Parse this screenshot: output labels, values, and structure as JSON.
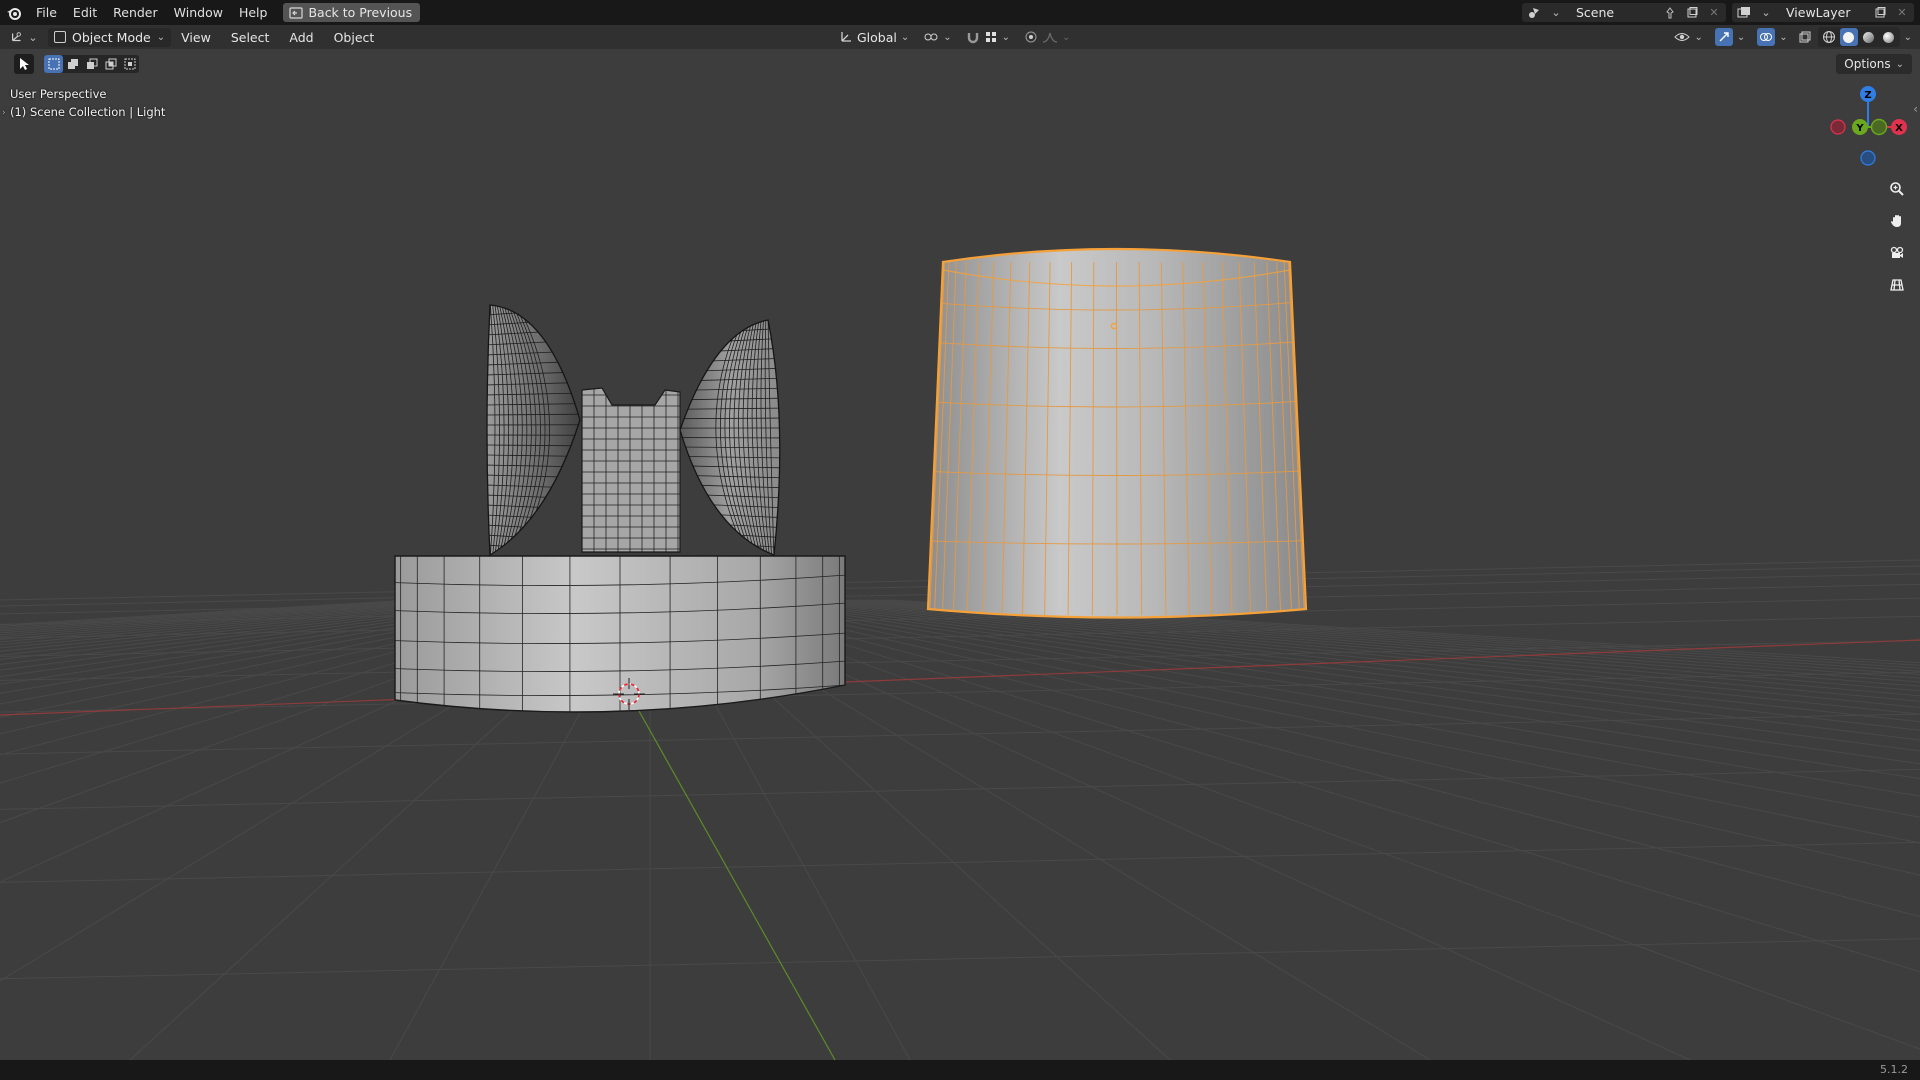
{
  "menubar": {
    "items": [
      "File",
      "Edit",
      "Render",
      "Window",
      "Help"
    ],
    "back_button": "Back to Previous",
    "scene_name": "Scene",
    "view_layer": "ViewLayer"
  },
  "header": {
    "mode": "Object Mode",
    "menus": [
      "View",
      "Select",
      "Add",
      "Object"
    ],
    "transform_orientation": "Global"
  },
  "toolbar": {
    "options_label": "Options"
  },
  "viewport": {
    "perspective_label": "User Perspective",
    "collection_label": "(1) Scene Collection | Light"
  },
  "gizmo": {
    "axis_z": "Z",
    "axis_y": "Y",
    "axis_x": "X",
    "colors": {
      "x": "#e0324e",
      "y": "#6ca81e",
      "z": "#2f7ee6"
    }
  },
  "colors": {
    "selection_outline": "#f5a13a",
    "active_blue": "#4772b3",
    "background": "#3d3d3d"
  },
  "statusbar": {
    "version": "5.1.2"
  }
}
